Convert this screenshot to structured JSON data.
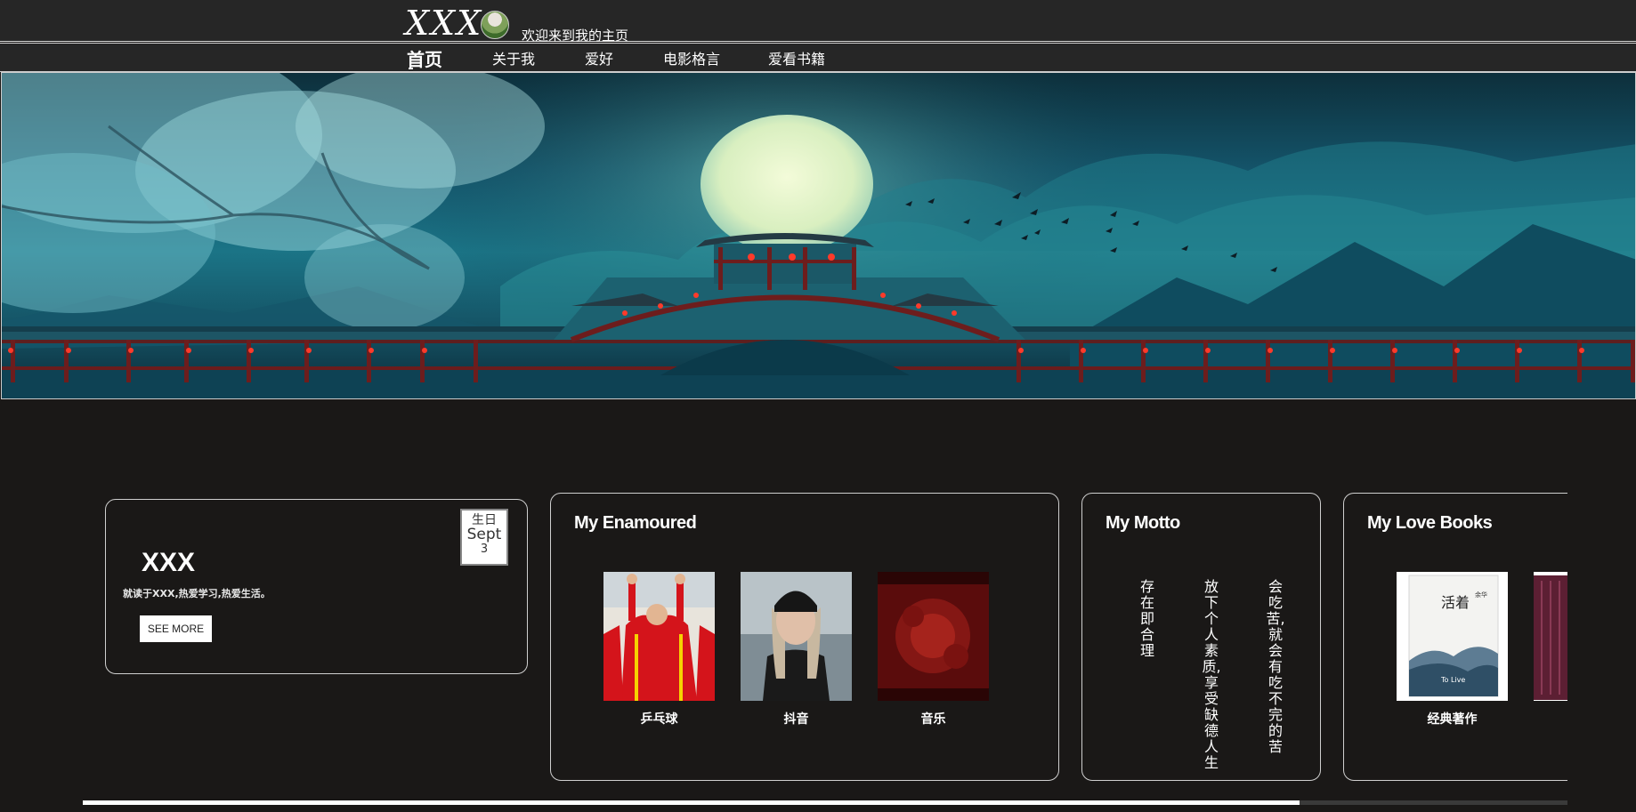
{
  "header": {
    "logo": "XXX",
    "welcome": "欢迎来到我的主页"
  },
  "nav": {
    "items": [
      "首页",
      "关于我",
      "爱好",
      "电影格言",
      "爱看书籍"
    ]
  },
  "profile": {
    "name": "XXX",
    "desc": "就读于XXX,热爱学习,热爱生活。",
    "button": "SEE MORE",
    "calendar": {
      "label": "生日",
      "month": "Sept",
      "day": "3"
    }
  },
  "enamoured": {
    "title": "My Enamoured",
    "items": [
      {
        "label": "乒乓球"
      },
      {
        "label": "抖音"
      },
      {
        "label": "音乐"
      }
    ]
  },
  "motto": {
    "title": "My Motto",
    "lines": [
      "存在即合理",
      "放下个人素质,享受缺德人生",
      "会吃苦,就会有吃不完的苦"
    ]
  },
  "books": {
    "title": "My Love Books",
    "items": [
      {
        "label": "经典著作",
        "cover_title": "活着",
        "cover_author": "余华",
        "cover_sub": "To Live"
      }
    ]
  },
  "colors": {
    "background": "#1a1817",
    "header": "#262626"
  }
}
